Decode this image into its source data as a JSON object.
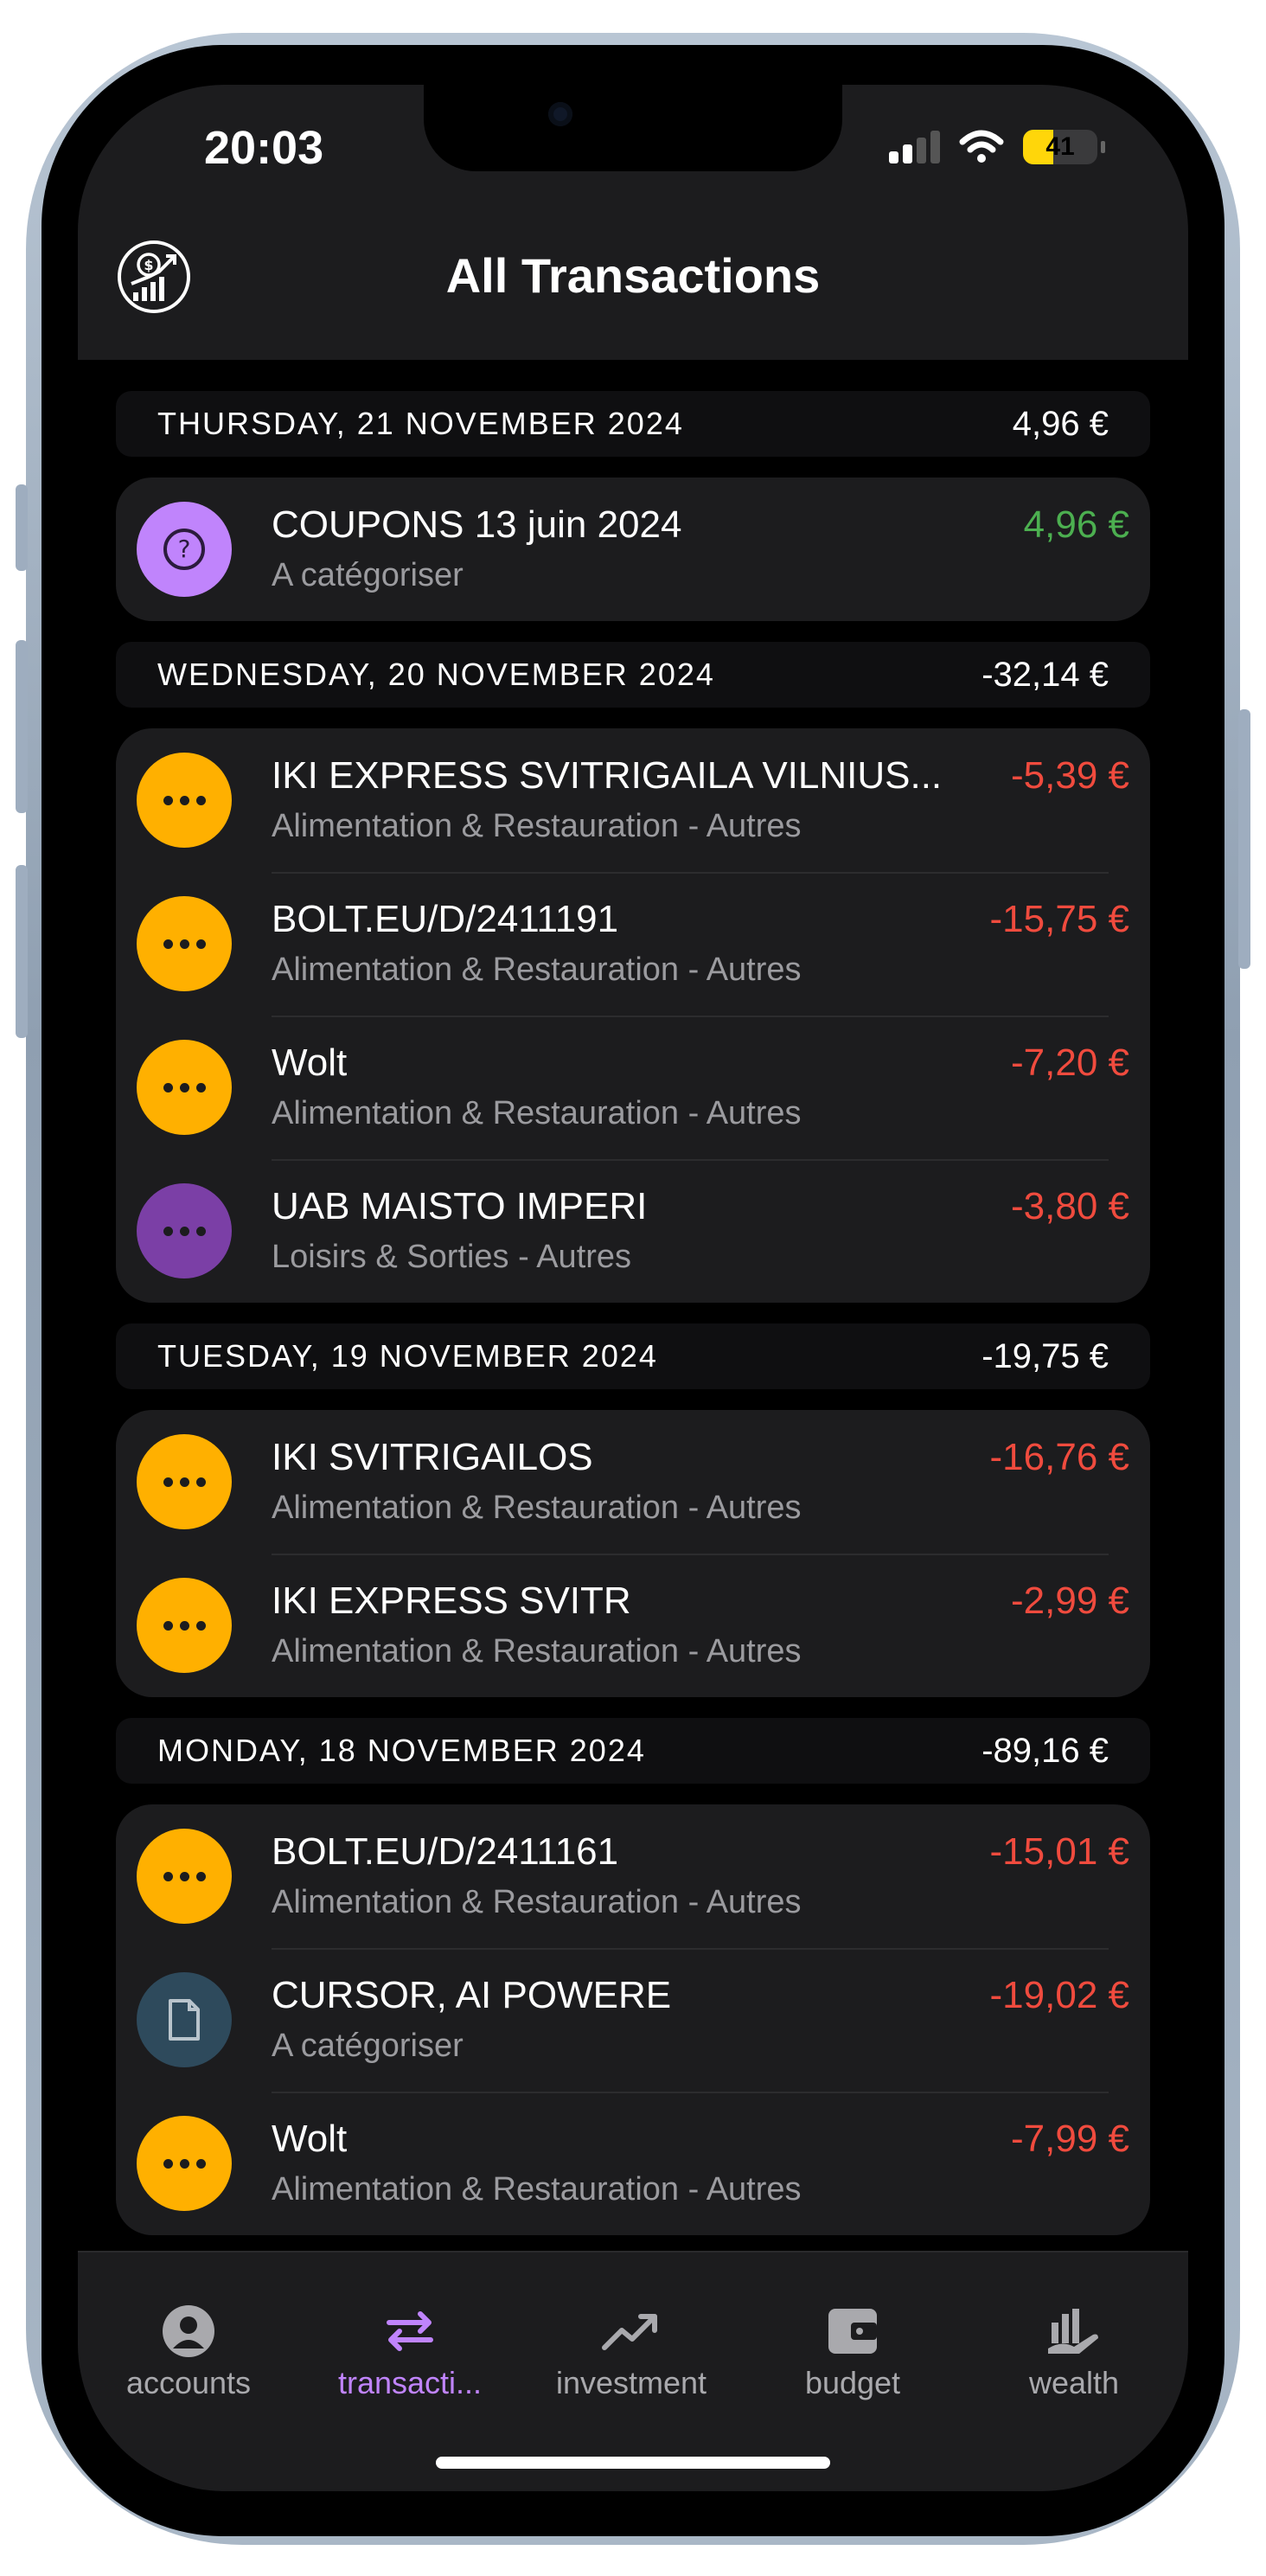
{
  "status_bar": {
    "time": "20:03",
    "battery": "41",
    "battery_level": 0.41
  },
  "header": {
    "title": "All Transactions",
    "logo_icon": "finance-growth-icon"
  },
  "colors": {
    "positive": "#4caf50",
    "negative": "#f04b3e",
    "accent": "#c084fc",
    "yellow": "#ffb000",
    "purple": "#c084fc",
    "dark_purple": "#7b3fa6",
    "slate": "#2e4a5c"
  },
  "days": [
    {
      "date": "THURSDAY, 21 NOVEMBER 2024",
      "total": "4,96 €",
      "total_sign": "pos",
      "transactions": [
        {
          "name": "COUPONS 13 juin 2024",
          "category": "A catégoriser",
          "amount": "4,96 €",
          "sign": "pos",
          "icon": "question-icon"
        }
      ]
    },
    {
      "date": "WEDNESDAY, 20 NOVEMBER 2024",
      "total": "-32,14 €",
      "total_sign": "neutral",
      "transactions": [
        {
          "name": "IKI EXPRESS SVITRIGAILA VILNIUS...",
          "category": "Alimentation & Restauration - Autres",
          "amount": "-5,39 €",
          "sign": "neg",
          "icon": "more-dots-icon"
        },
        {
          "name": "BOLT.EU/D/2411191",
          "category": "Alimentation & Restauration - Autres",
          "amount": "-15,75 €",
          "sign": "neg",
          "icon": "more-dots-icon"
        },
        {
          "name": "Wolt",
          "category": "Alimentation & Restauration - Autres",
          "amount": "-7,20 €",
          "sign": "neg",
          "icon": "more-dots-icon"
        },
        {
          "name": "UAB MAISTO IMPERI",
          "category": "Loisirs & Sorties - Autres",
          "amount": "-3,80 €",
          "sign": "neg",
          "icon": "more-dots-icon"
        }
      ]
    },
    {
      "date": "TUESDAY, 19 NOVEMBER 2024",
      "total": "-19,75 €",
      "total_sign": "neutral",
      "transactions": [
        {
          "name": "IKI SVITRIGAILOS",
          "category": "Alimentation & Restauration - Autres",
          "amount": "-16,76 €",
          "sign": "neg",
          "icon": "more-dots-icon"
        },
        {
          "name": "IKI EXPRESS SVITR",
          "category": "Alimentation & Restauration - Autres",
          "amount": "-2,99 €",
          "sign": "neg",
          "icon": "more-dots-icon"
        }
      ]
    },
    {
      "date": "MONDAY, 18 NOVEMBER 2024",
      "total": "-89,16 €",
      "total_sign": "neutral",
      "transactions": [
        {
          "name": "BOLT.EU/D/2411161",
          "category": "Alimentation & Restauration - Autres",
          "amount": "-15,01 €",
          "sign": "neg",
          "icon": "more-dots-icon"
        },
        {
          "name": "CURSOR, AI POWERE",
          "category": "A catégoriser",
          "amount": "-19,02 €",
          "sign": "neg",
          "icon": "document-icon"
        },
        {
          "name": "Wolt",
          "category": "Alimentation & Restauration - Autres",
          "amount": "-7,99 €",
          "sign": "neg",
          "icon": "more-dots-icon"
        }
      ]
    }
  ],
  "tabbar": [
    {
      "label": "accounts",
      "icon": "person-circle-icon",
      "active": false
    },
    {
      "label": "transacti...",
      "icon": "swap-arrows-icon",
      "active": true
    },
    {
      "label": "investment",
      "icon": "trend-up-icon",
      "active": false
    },
    {
      "label": "budget",
      "icon": "wallet-icon",
      "active": false
    },
    {
      "label": "wealth",
      "icon": "chart-hand-icon",
      "active": false
    }
  ]
}
